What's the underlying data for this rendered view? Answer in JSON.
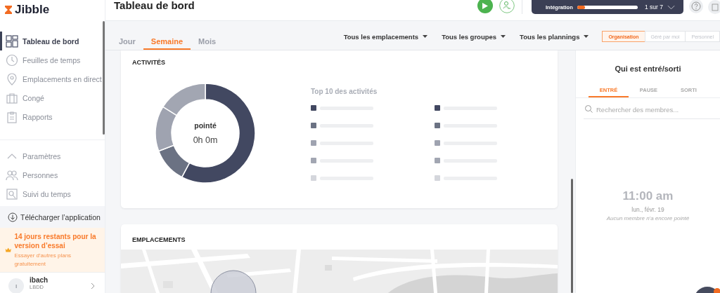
{
  "logo": {
    "text": "Jibble"
  },
  "sidebar": {
    "items": [
      {
        "label": "Tableau de bord",
        "kind": "grid",
        "selected": true
      },
      {
        "label": "Feuilles de temps",
        "kind": "clock",
        "selected": false
      },
      {
        "label": "Emplacements en direct",
        "kind": "pin",
        "selected": false
      },
      {
        "label": "Congé",
        "kind": "suitcase",
        "selected": false
      },
      {
        "label": "Rapports",
        "kind": "clipboard",
        "selected": false
      }
    ],
    "settings": [
      {
        "label": "Paramètres",
        "kind": "chevron"
      },
      {
        "label": "Personnes",
        "kind": "people"
      },
      {
        "label": "Suivi du temps",
        "kind": "tracking"
      }
    ],
    "download": "Télécharger l’application",
    "trial": {
      "title": "14 jours restants pour la version d’essai",
      "link": "Essayer d'autres plans gratuitement"
    },
    "user": {
      "initial": "I",
      "name": "ibach",
      "org": "LBDD"
    }
  },
  "header": {
    "title": "Tableau de bord",
    "onboarding": {
      "label": "Intégration",
      "level": 0.13,
      "step": "1 sur 7"
    }
  },
  "period_tabs": [
    {
      "label": "Jour",
      "selected": false
    },
    {
      "label": "Semaine",
      "selected": true
    },
    {
      "label": "Mois",
      "selected": false
    }
  ],
  "filters": [
    {
      "label": "Tous les emplacements"
    },
    {
      "label": "Tous les groupes"
    },
    {
      "label": "Tous les plannings"
    }
  ],
  "scope_tabs": [
    {
      "label": "Organisation",
      "selected": true
    },
    {
      "label": "Géré par moi",
      "selected": false
    },
    {
      "label": "Personnel",
      "selected": false
    }
  ],
  "activities": {
    "title": "ACTIVITÉS",
    "center_label": "pointé",
    "center_value": "0h 0m",
    "legend_title": "Top 10 des activités"
  },
  "locations": {
    "title": "EMPLACEMENTS"
  },
  "who": {
    "title": "Qui est entré/sorti",
    "tabs": [
      {
        "label": "ENTRÉ",
        "selected": true
      },
      {
        "label": "PAUSE",
        "selected": false
      },
      {
        "label": "SORTI",
        "selected": false
      }
    ],
    "search": {
      "placeholder": "Rechercher des membres..."
    },
    "time": "11:00 am",
    "date": "lun., févr. 19",
    "empty": "Aucun membre n'a encore pointé"
  }
}
